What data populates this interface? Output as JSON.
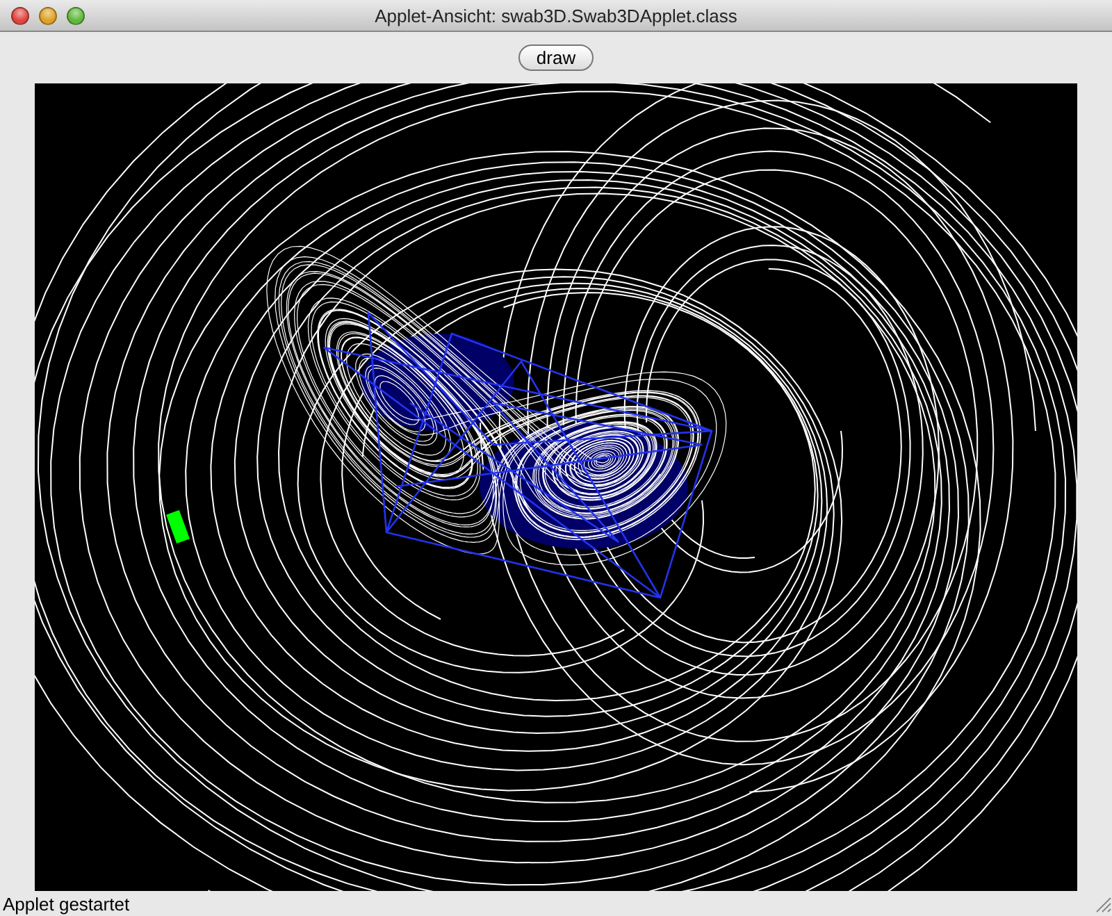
{
  "window": {
    "title": "Applet-Ansicht: swab3D.Swab3DApplet.class"
  },
  "toolbar": {
    "button": "draw"
  },
  "status_bar": {
    "text": "Applet gestartet"
  }
}
